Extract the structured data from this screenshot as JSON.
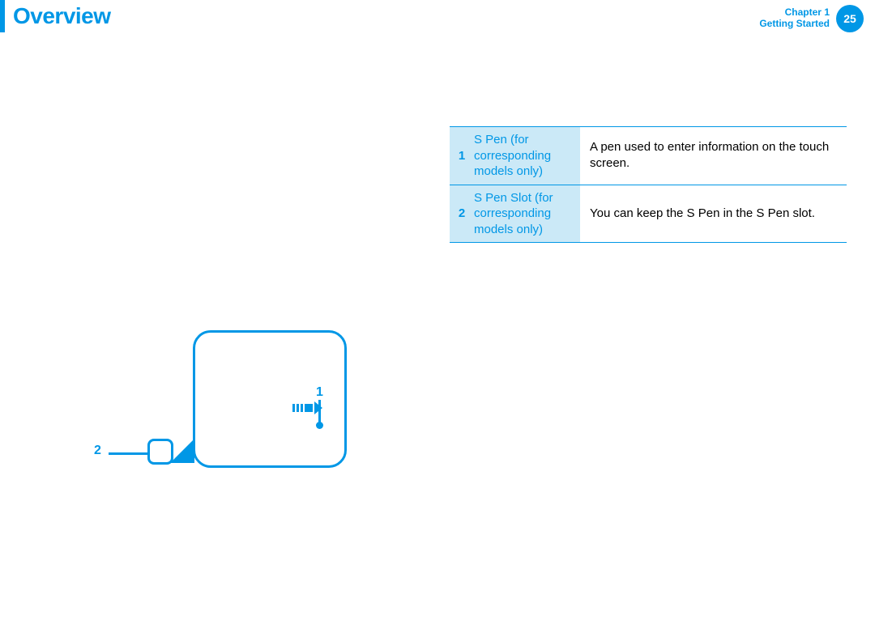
{
  "header": {
    "title": "Overview",
    "chapter_line1": "Chapter 1",
    "chapter_line2": "Getting Started",
    "page_number": "25"
  },
  "table": {
    "rows": [
      {
        "num": "1",
        "label": "S Pen (for corresponding models only)",
        "desc": "A pen used to enter information on the touch screen."
      },
      {
        "num": "2",
        "label": "S Pen Slot (for corresponding models only)",
        "desc": "You can keep the S Pen in the S Pen slot."
      }
    ]
  },
  "diagram": {
    "callout1": "1",
    "callout2": "2"
  }
}
